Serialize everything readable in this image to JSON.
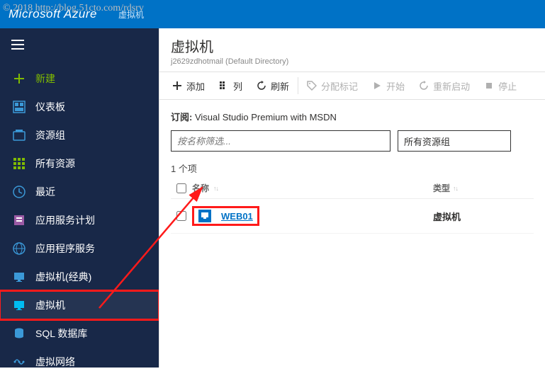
{
  "watermark": "© 2018 http://blog.51cto.com/rdsrv",
  "topbar": {
    "brand": "Microsoft Azure",
    "breadcrumb": "虚拟机"
  },
  "sidebar": {
    "new_label": "新建",
    "items": [
      {
        "label": "仪表板"
      },
      {
        "label": "资源组"
      },
      {
        "label": "所有资源"
      },
      {
        "label": "最近"
      },
      {
        "label": "应用服务计划"
      },
      {
        "label": "应用程序服务"
      },
      {
        "label": "虚拟机(经典)"
      },
      {
        "label": "虚拟机"
      },
      {
        "label": "SQL 数据库"
      },
      {
        "label": "虚拟网络"
      }
    ]
  },
  "blade": {
    "title": "虚拟机",
    "subtitle": "j2629zdhotmail (Default Directory)"
  },
  "toolbar": {
    "add": "添加",
    "columns": "列",
    "refresh": "刷新",
    "tag": "分配标记",
    "start": "开始",
    "restart": "重新启动",
    "stop": "停止"
  },
  "subscription": {
    "label": "订阅:",
    "value": "Visual Studio Premium with MSDN"
  },
  "filters": {
    "placeholder": "按名称筛选...",
    "resource_group": "所有资源组"
  },
  "count_label": "1 个项",
  "grid": {
    "headers": {
      "name": "名称",
      "type": "类型"
    },
    "rows": [
      {
        "name": "WEB01",
        "type": "虚拟机"
      }
    ]
  }
}
